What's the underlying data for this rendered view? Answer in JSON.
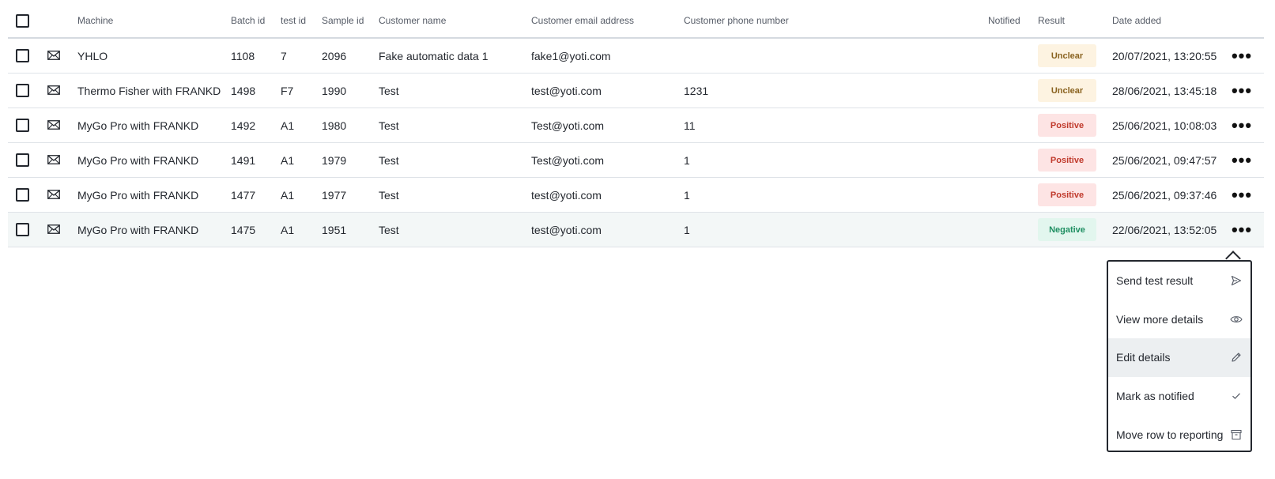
{
  "header": {
    "machine": "Machine",
    "batch_id": "Batch id",
    "test_id": "test id",
    "sample_id": "Sample id",
    "customer_name": "Customer name",
    "customer_email": "Customer email address",
    "customer_phone": "Customer phone number",
    "notified": "Notified",
    "result": "Result",
    "date_added": "Date added"
  },
  "rows": [
    {
      "machine": "YHLO",
      "batch_id": "1108",
      "test_id": "7",
      "sample_id": "2096",
      "customer_name": "Fake automatic data 1",
      "email": "fake1@yoti.com",
      "phone": "",
      "result": "Unclear",
      "date_added": "20/07/2021, 13:20:55"
    },
    {
      "machine": "Thermo Fisher with FRANKD",
      "batch_id": "1498",
      "test_id": "F7",
      "sample_id": "1990",
      "customer_name": "Test",
      "email": "test@yoti.com",
      "phone": "1231",
      "result": "Unclear",
      "date_added": "28/06/2021, 13:45:18"
    },
    {
      "machine": "MyGo Pro with FRANKD",
      "batch_id": "1492",
      "test_id": "A1",
      "sample_id": "1980",
      "customer_name": "Test",
      "email": "Test@yoti.com",
      "phone": "11",
      "result": "Positive",
      "date_added": "25/06/2021, 10:08:03"
    },
    {
      "machine": "MyGo Pro with FRANKD",
      "batch_id": "1491",
      "test_id": "A1",
      "sample_id": "1979",
      "customer_name": "Test",
      "email": "Test@yoti.com",
      "phone": "1",
      "result": "Positive",
      "date_added": "25/06/2021, 09:47:57"
    },
    {
      "machine": "MyGo Pro with FRANKD",
      "batch_id": "1477",
      "test_id": "A1",
      "sample_id": "1977",
      "customer_name": "Test",
      "email": "test@yoti.com",
      "phone": "1",
      "result": "Positive",
      "date_added": "25/06/2021, 09:37:46"
    },
    {
      "machine": "MyGo Pro with FRANKD",
      "batch_id": "1475",
      "test_id": "A1",
      "sample_id": "1951",
      "customer_name": "Test",
      "email": "test@yoti.com",
      "phone": "1",
      "result": "Negative",
      "date_added": "22/06/2021, 13:52:05"
    }
  ],
  "selected_row_index": 5,
  "result_colors": {
    "Unclear": {
      "bg": "#fdf3e1",
      "fg": "#8a6320"
    },
    "Positive": {
      "bg": "#fde4e4",
      "fg": "#c0392b"
    },
    "Negative": {
      "bg": "#e2f6ee",
      "fg": "#1f8f62"
    }
  },
  "row_icons": {
    "mail": "mail-icon",
    "more": "more-dots-icon"
  },
  "context_menu": {
    "items": [
      {
        "label": "Send test result",
        "icon": "send-icon"
      },
      {
        "label": "View more details",
        "icon": "eye-icon"
      },
      {
        "label": "Edit details",
        "icon": "pencil-icon"
      },
      {
        "label": "Mark as notified",
        "icon": "checkmark-icon"
      },
      {
        "label": "Move row to reporting",
        "icon": "archive-icon"
      }
    ],
    "active_index": 2
  }
}
